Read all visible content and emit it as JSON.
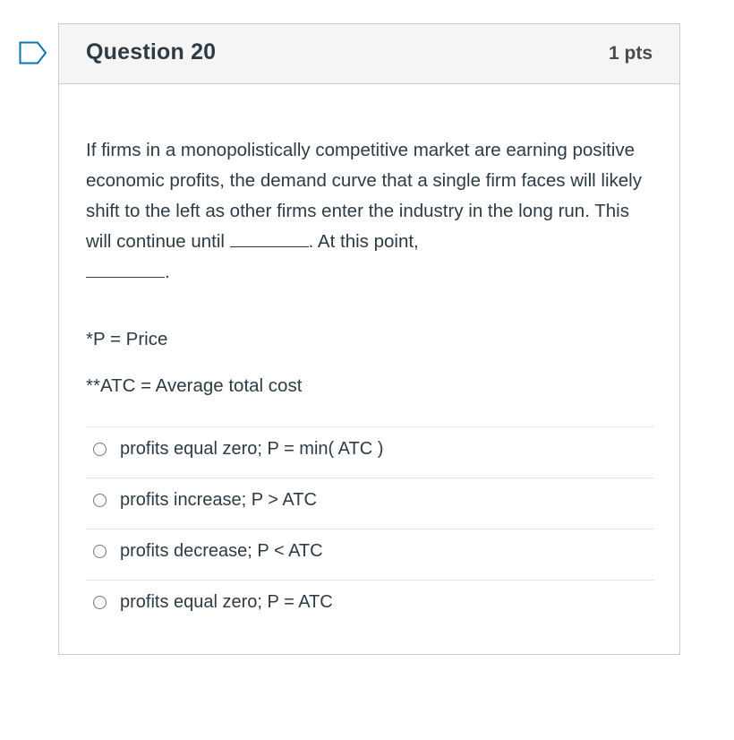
{
  "question": {
    "title": "Question 20",
    "points": "1 pts",
    "text_part1": "If firms in a monopolistically competitive market are earning positive economic profits, the demand curve that a single firm faces will likely shift to the left as other firms enter the industry in the long run. This will continue until ",
    "text_part2": ". At this point,",
    "text_end": ".",
    "note1": "*P = Price",
    "note2": "**ATC = Average total cost"
  },
  "answers": [
    {
      "label": "profits equal zero; P = min( ATC )"
    },
    {
      "label": "profits increase; P > ATC"
    },
    {
      "label": "profits decrease; P < ATC"
    },
    {
      "label": "profits equal zero; P = ATC"
    }
  ],
  "icons": {
    "flag": "flag-icon",
    "radio": "radio-button-icon"
  },
  "colors": {
    "text": "#2d3b45",
    "header_bg": "#f5f5f5",
    "border": "#c7cdd1",
    "flag": "#0374b5"
  }
}
